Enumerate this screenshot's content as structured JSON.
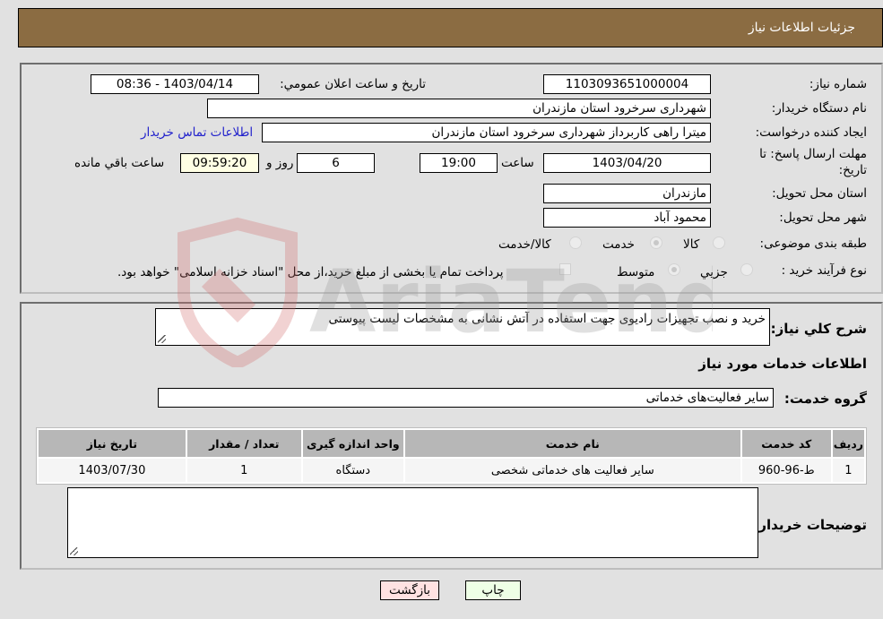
{
  "header": {
    "title": "جزئیات اطلاعات نیاز"
  },
  "form": {
    "need_number": {
      "label": "شماره نیاز:",
      "value": "1103093651000004"
    },
    "announce_datetime": {
      "label": "تاریخ و ساعت اعلان عمومي:",
      "value": "1403/04/14 - 08:36"
    },
    "buyer_org": {
      "label": "نام دستگاه خریدار:",
      "value": "شهرداری سرخرود استان مازندران"
    },
    "requester": {
      "label": "ایجاد کننده درخواست:",
      "value": "میترا راهی کاربرداز شهرداری سرخرود استان مازندران"
    },
    "buyer_contact_link": "اطلاعات تماس خریدار",
    "deadline": {
      "label_line1": "مهلت ارسال پاسخ: تا",
      "label_line2": "تاریخ:",
      "date": "1403/04/20",
      "time_label": "ساعت",
      "time": "19:00",
      "days": "6",
      "days_label": "روز و",
      "remaining": "09:59:20",
      "remaining_label": "ساعت باقي مانده"
    },
    "delivery_province": {
      "label": "استان محل تحویل:",
      "value": "مازندران"
    },
    "delivery_city": {
      "label": "شهر محل تحویل:",
      "value": "محمود آباد"
    },
    "category": {
      "label": "طبقه بندی موضوعی:",
      "options": [
        "کالا",
        "خدمت",
        "کالا/خدمت"
      ],
      "selected": "خدمت"
    },
    "purchase_type": {
      "label": "نوع فرآیند خرید :",
      "options": [
        "جزیي",
        "متوسط"
      ],
      "selected": "متوسط",
      "treasury_note": "پرداخت تمام یا بخشی از مبلغ خرید،از محل \"اسناد خزانه اسلامی\" خواهد بود."
    }
  },
  "details": {
    "description_label": "شرح كلي نیاز:",
    "description": "خرید و نصب تجهیزات رادیوی جهت استفاده در آتش نشانی به مشخصات لیست پیوستی",
    "services_heading": "اطلاعات خدمات مورد نیاز",
    "service_group_label": "گروه خدمت:",
    "service_group": "سایر فعالیت‌های خدماتی",
    "table": {
      "headers": [
        "ردیف",
        "کد خدمت",
        "نام خدمت",
        "واحد اندازه گیری",
        "تعداد / مقدار",
        "تاریخ نیاز"
      ],
      "rows": [
        [
          "1",
          "ط-96-960",
          "سایر فعالیت های خدماتی شخصی",
          "دستگاه",
          "1",
          "1403/07/30"
        ]
      ]
    },
    "buyer_notes_label": "توضیحات خریدار:",
    "buyer_notes": ""
  },
  "buttons": {
    "print": "چاپ",
    "back": "بازگشت"
  },
  "watermark": {
    "text": "AriaTender.neT"
  }
}
